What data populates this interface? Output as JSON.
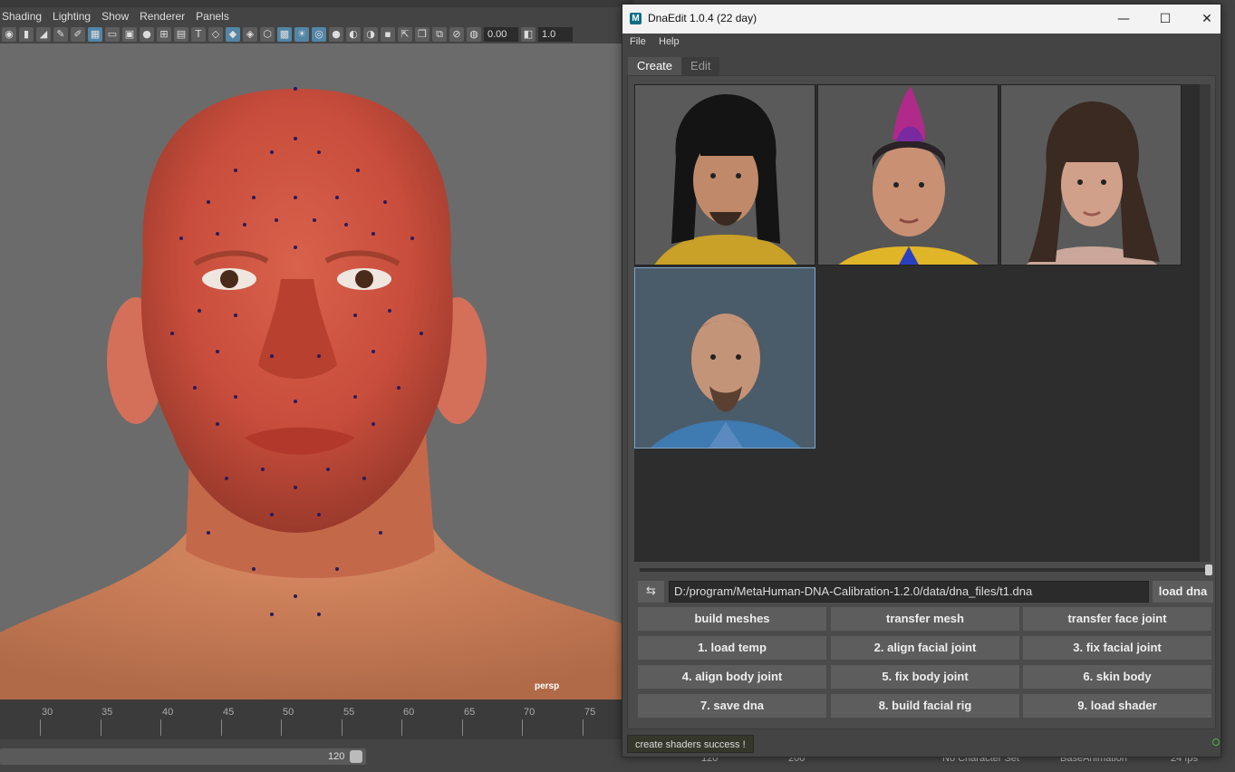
{
  "maya": {
    "menu": [
      "Shading",
      "Lighting",
      "Show",
      "Renderer",
      "Panels"
    ],
    "toolbar": {
      "exposure_value": "0.00",
      "gamma_value": "1.0"
    },
    "viewport_label": "persp",
    "timeline_ticks": [
      "30",
      "35",
      "40",
      "45",
      "50",
      "55",
      "60",
      "65",
      "70",
      "75"
    ],
    "range_end_value": "120",
    "status_bar": {
      "start_value": "120",
      "end_value": "200",
      "character_set": "No Character Set",
      "anim_layer": "BaseAnimation",
      "fps": "24 fps"
    }
  },
  "window": {
    "title": "DnaEdit 1.0.4 (22 day)",
    "app_icon": "M",
    "minimize_icon": "minimize-icon",
    "maximize_icon": "maximize-icon",
    "close_icon": "close-icon"
  },
  "menubar": {
    "file": "File",
    "help": "Help"
  },
  "tabs": [
    {
      "label": "Create",
      "active": true
    },
    {
      "label": "Edit",
      "active": false
    }
  ],
  "gallery": {
    "items": [
      {
        "name": "asian-male-long-hair",
        "selected": false
      },
      {
        "name": "female-pink-mohawk",
        "selected": false
      },
      {
        "name": "female-curly-hair",
        "selected": false
      },
      {
        "name": "older-male-goatee",
        "selected": true
      }
    ]
  },
  "dna_path": {
    "value": "D:/program/MetaHuman-DNA-Calibration-1.2.0/data/dna_files/t1.dna",
    "swap_icon": "swap-icon",
    "load_label": "load dna"
  },
  "buttons": [
    [
      "build meshes",
      "transfer mesh",
      "transfer face joint"
    ],
    [
      "1. load temp",
      "2. align facial joint",
      "3. fix facial joint"
    ],
    [
      "4. align body joint",
      "5. fix body joint",
      "6. skin body"
    ],
    [
      "7. save dna",
      "8. build facial rig",
      "9. load shader"
    ]
  ],
  "status": {
    "message": "create shaders success !",
    "indicator_color": "#4caf50"
  },
  "colors": {
    "accent": "#5285a6",
    "button_bg": "#5d5d5d",
    "panel_bg": "#444444"
  }
}
